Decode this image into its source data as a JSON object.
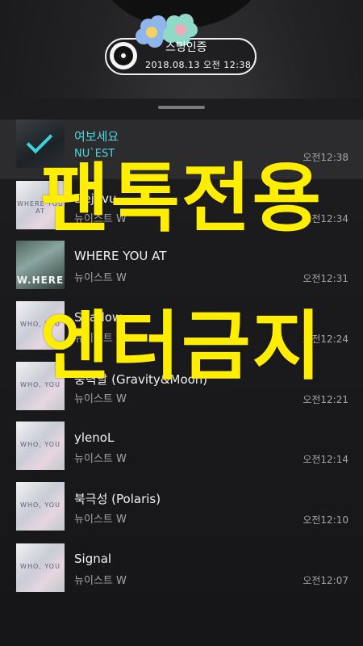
{
  "proof": {
    "title": "스밍인증",
    "date": "2018.08.13 오전 12:38",
    "icon": "vinyl-record-icon",
    "sticker": "flower-sticker"
  },
  "watermark": {
    "line1": "팬톡전용",
    "line2": "엔터금지",
    "color": "#ffee00"
  },
  "playlist": [
    {
      "title": "여보세요",
      "artist": "NU`EST",
      "time": "오전12:38",
      "cover_text": "",
      "current": true
    },
    {
      "title": "Dejavu",
      "artist": "뉴이스트 W",
      "time": "오전12:34",
      "cover_text": "WHERE YOU AT"
    },
    {
      "title": "WHERE YOU AT",
      "artist": "뉴이스트 W",
      "time": "오전12:31",
      "cover_text": "W.HERE"
    },
    {
      "title": "Shadow",
      "artist": "뉴이스트 W",
      "time": "오전12:24",
      "cover_text": "WHO, YOU"
    },
    {
      "title": "중력달 (Gravity&Moon)",
      "artist": "뉴이스트 W",
      "time": "오전12:21",
      "cover_text": "WHO, YOU"
    },
    {
      "title": "ylenoL",
      "artist": "뉴이스트 W",
      "time": "오전12:14",
      "cover_text": "WHO, YOU"
    },
    {
      "title": "북극성 (Polaris)",
      "artist": "뉴이스트 W",
      "time": "오전12:10",
      "cover_text": "WHO, YOU"
    },
    {
      "title": "Signal",
      "artist": "뉴이스트 W",
      "time": "오전12:07",
      "cover_text": "WHO, YOU"
    }
  ],
  "colors": {
    "accent": "#4fd6df",
    "text": "#f2f2f2",
    "subtext": "#a5a5a8"
  }
}
